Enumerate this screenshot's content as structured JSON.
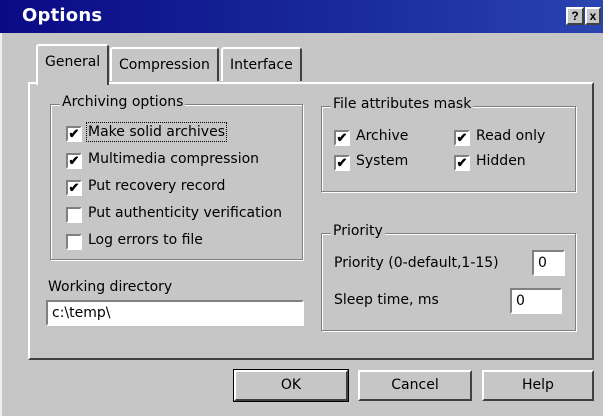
{
  "window": {
    "title": "Options",
    "help_glyph": "?",
    "close_glyph": "x"
  },
  "tabs": [
    {
      "label": "General",
      "active": true
    },
    {
      "label": "Compression",
      "active": false
    },
    {
      "label": "Interface",
      "active": false
    }
  ],
  "archiving": {
    "title": "Archiving options",
    "items": [
      {
        "label": "Make solid archives",
        "checked": true
      },
      {
        "label": "Multimedia compression",
        "checked": true
      },
      {
        "label": "Put recovery record",
        "checked": true
      },
      {
        "label": "Put authenticity verification",
        "checked": false
      },
      {
        "label": "Log errors to file",
        "checked": false
      }
    ]
  },
  "working_dir": {
    "label": "Working directory",
    "value": "c:\\temp\\"
  },
  "attrs": {
    "title": "File attributes mask",
    "items": [
      {
        "label": "Archive",
        "checked": true
      },
      {
        "label": "Read only",
        "checked": true
      },
      {
        "label": "System",
        "checked": true
      },
      {
        "label": "Hidden",
        "checked": true
      }
    ]
  },
  "priority": {
    "title": "Priority",
    "priority_label": "Priority  (0-default,1-15)",
    "priority_value": "0",
    "sleep_label": "Sleep time, ms",
    "sleep_value": "0"
  },
  "buttons": {
    "ok": "OK",
    "cancel": "Cancel",
    "help": "Help"
  },
  "check_glyph": "✔"
}
